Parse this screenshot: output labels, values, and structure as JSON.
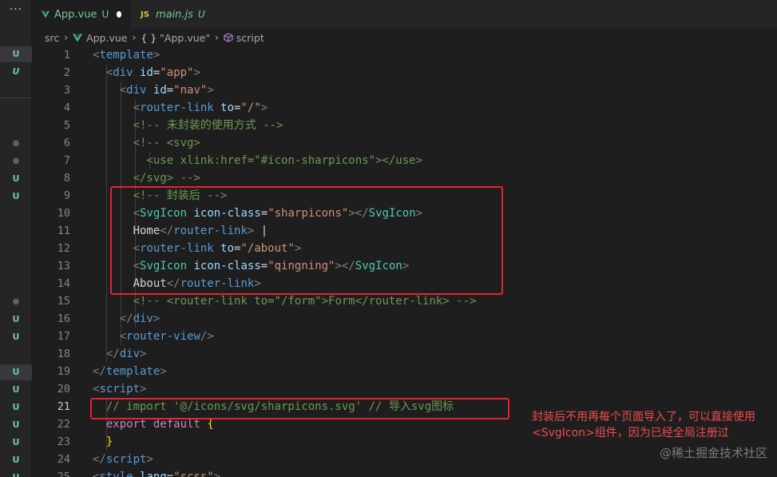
{
  "tabs": [
    {
      "label": "App.vue",
      "status": "U",
      "type": "vue"
    },
    {
      "icon_label": "JS",
      "label": "main.js",
      "status": "U",
      "type": "js"
    }
  ],
  "breadcrumb": [
    "src",
    "App.vue",
    "{ }",
    "\"App.vue\"",
    "script"
  ],
  "sidebar": {
    "dots": "···",
    "rows": [
      {
        "label": "U"
      },
      {
        "label": "U"
      },
      {
        "label": "●"
      },
      {
        "label": "●"
      },
      {
        "label": "U"
      },
      {
        "label": "U"
      },
      {
        "label": "●"
      },
      {
        "label": "U"
      },
      {
        "label": "U"
      },
      {
        "label": "U"
      },
      {
        "label": "U"
      },
      {
        "label": "U"
      },
      {
        "label": "U"
      },
      {
        "label": "U"
      },
      {
        "label": "U"
      },
      {
        "label": "U"
      }
    ]
  },
  "editor": {
    "current_line": 21,
    "lines": [
      {
        "n": "1"
      },
      {
        "n": "2"
      },
      {
        "n": "3"
      },
      {
        "n": "4"
      },
      {
        "n": "5"
      },
      {
        "n": "6"
      },
      {
        "n": "7"
      },
      {
        "n": "8"
      },
      {
        "n": "9"
      },
      {
        "n": "10"
      },
      {
        "n": "11"
      },
      {
        "n": "12"
      },
      {
        "n": "13"
      },
      {
        "n": "14"
      },
      {
        "n": "15"
      },
      {
        "n": "16"
      },
      {
        "n": "17"
      },
      {
        "n": "18"
      },
      {
        "n": "19"
      },
      {
        "n": "20"
      },
      {
        "n": "21"
      },
      {
        "n": "22"
      },
      {
        "n": "23"
      },
      {
        "n": "24"
      },
      {
        "n": "25"
      }
    ],
    "code": {
      "l1_tag": "template",
      "l2_tag": "div",
      "l2_attr": "id",
      "l2_val": "\"app\"",
      "l3_tag": "div",
      "l3_attr": "id",
      "l3_val": "\"nav\"",
      "l4_tag": "router-link",
      "l4_attr": "to",
      "l4_val": "\"/\"",
      "l5": "<!-- 未封装的使用方式 -->",
      "l6": "<!-- <svg>",
      "l7": "<use xlink:href=\"#icon-sharpicons\"></use>",
      "l8": "</svg> -->",
      "l9": "<!-- 封装后 -->",
      "l10_tag": "SvgIcon",
      "l10_attr": "icon-class",
      "l10_val": "\"sharpicons\"",
      "l10_close": "SvgIcon",
      "l11_text": "Home",
      "l11_close": "router-link",
      "l11_pipe": " |",
      "l12_tag": "router-link",
      "l12_attr": "to",
      "l12_val": "\"/about\"",
      "l13_tag": "SvgIcon",
      "l13_attr": "icon-class",
      "l13_val": "\"qingning\"",
      "l13_close": "SvgIcon",
      "l14_text": "About",
      "l14_close": "router-link",
      "l15": "<!-- <router-link to=\"/form\">Form</router-link> -->",
      "l16_close": "div",
      "l17_tag": "router-view",
      "l18_close": "div",
      "l19_close": "template",
      "l20_tag": "script",
      "l21": "// import '@/icons/svg/sharpicons.svg' // 导入svg图标",
      "l22_kw1": "export",
      "l22_kw2": "default",
      "l22_brace": "{",
      "l23_brace": "}",
      "l24_close": "script",
      "l25_tag": "style",
      "l25_attr": "lang",
      "l25_val": "\"scss\""
    }
  },
  "annotation": "封装后不用再每个页面导入了，可以直接使用<SvgIcon>组件，因为已经全局注册过",
  "watermark": "@稀土掘金技术社区",
  "colors": {
    "highlight": "#e8222f",
    "annotation": "#f14c4c",
    "untracked": "#73c991"
  }
}
